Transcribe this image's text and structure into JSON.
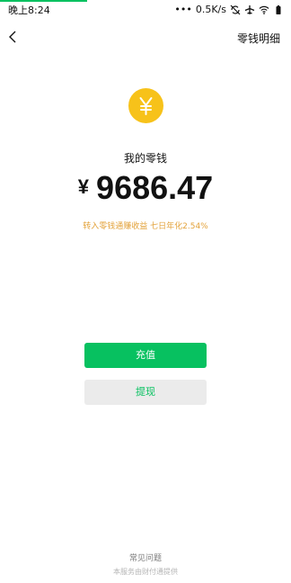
{
  "status_bar": {
    "time": "晚上8:24",
    "network_speed": "0.5K/s",
    "icons": [
      "sync-off-icon",
      "airplane-mode-icon",
      "wifi-icon",
      "battery-icon"
    ],
    "accent_color": "#07c160"
  },
  "nav": {
    "back_icon": "chevron-left-icon",
    "right_label": "零钱明细"
  },
  "wallet": {
    "coin_icon": "yen-coin-icon",
    "coin_color": "#f7c21a",
    "label": "我的零钱",
    "currency_symbol": "¥",
    "amount": "9686.47",
    "promo": "转入零钱通赚收益 七日年化2.54%"
  },
  "actions": {
    "recharge_label": "充值",
    "withdraw_label": "提现"
  },
  "footer": {
    "faq_label": "常见问题",
    "provider_text": "本服务由财付通提供"
  }
}
